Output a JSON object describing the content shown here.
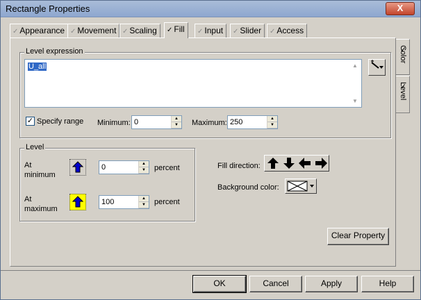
{
  "window": {
    "title": "Rectangle Properties",
    "close_glyph": "X"
  },
  "tabs": [
    {
      "label": "Appearance",
      "checked": false
    },
    {
      "label": "Movement",
      "checked": false
    },
    {
      "label": "Scaling",
      "checked": false
    },
    {
      "label": "Fill",
      "checked": true
    },
    {
      "label": "Input",
      "checked": false
    },
    {
      "label": "Slider",
      "checked": false
    },
    {
      "label": "Access",
      "checked": false
    }
  ],
  "side_tabs": [
    {
      "label": "Color",
      "checked": true
    },
    {
      "label": "Level",
      "checked": true
    }
  ],
  "level_expression": {
    "group_label": "Level expression",
    "value": "U_all"
  },
  "range": {
    "specify_label": "Specify range",
    "specify_checked": true,
    "minimum_label": "Minimum:",
    "minimum_value": "0",
    "maximum_label": "Maximum:",
    "maximum_value": "250"
  },
  "level_group": {
    "group_label": "Level",
    "at_minimum_label_1": "At",
    "at_minimum_label_2": "minimum",
    "at_minimum_value": "0",
    "at_maximum_label_1": "At",
    "at_maximum_label_2": "maximum",
    "at_maximum_value": "100",
    "percent_label": "percent"
  },
  "fill": {
    "direction_label": "Fill direction:",
    "background_label": "Background color:"
  },
  "buttons": {
    "clear_property": "Clear Property",
    "ok": "OK",
    "cancel": "Cancel",
    "apply": "Apply",
    "help": "Help"
  },
  "colors": {
    "title_bar": "#8ea7cf",
    "close_button": "#c2442c",
    "selection": "#3169c6",
    "highlight": "#ffff00",
    "arrow_fill": "#0000cc"
  }
}
